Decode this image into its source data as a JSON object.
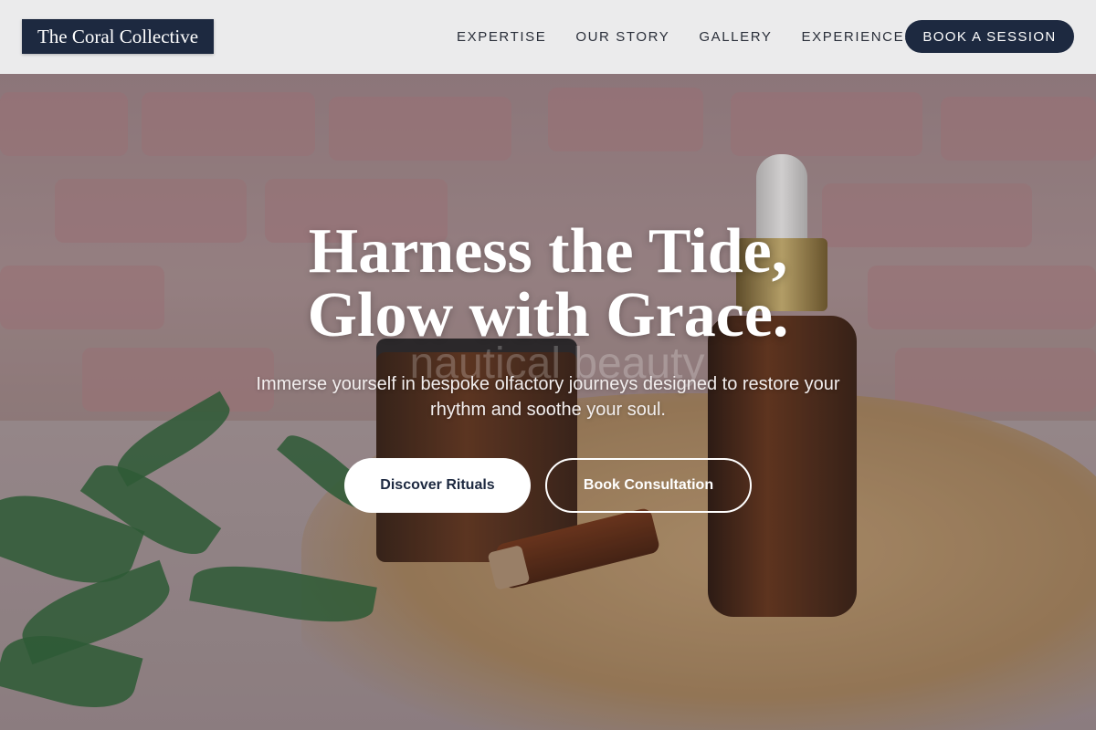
{
  "header": {
    "logo": "The Coral Collective",
    "nav": [
      "EXPERTISE",
      "OUR STORY",
      "GALLERY",
      "EXPERIENCES"
    ],
    "cta": "BOOK A SESSION"
  },
  "hero": {
    "title_line1": "Harness the Tide,",
    "title_line2": "Glow with Grace.",
    "background_text": "nautical beauty",
    "subtitle": "Immerse yourself in bespoke olfactory journeys designed to restore your rhythm and soothe your soul.",
    "primary_button": "Discover Rituals",
    "secondary_button": "Book Consultation"
  },
  "colors": {
    "brand_navy": "#1d2940",
    "header_bg": "#ebebec"
  }
}
